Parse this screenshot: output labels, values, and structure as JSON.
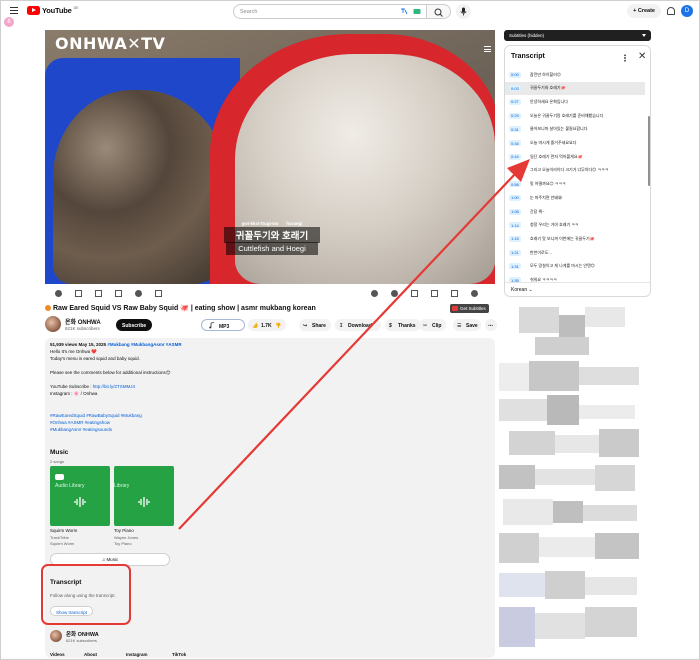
{
  "header": {
    "logo_text": "YouTube",
    "logo_sup": "DE",
    "search_placeholder": "Search",
    "create_label": "Create",
    "avatar_letter": "D",
    "side_badge": "8"
  },
  "player": {
    "watermark": "ONHWA✕TV",
    "caption_roman_1": "gwi-kkol-ttugi-wa",
    "caption_roman_2": "horaegi",
    "caption_korean": "귀꼴두기와 호래기",
    "caption_english": "Cuttlefish and Hoegi"
  },
  "video": {
    "title": "Raw Eared Squid VS Raw Baby Squid 🐙 | eating show | asmr mukbang korean",
    "get_subtitles_label": "Get Subtitles",
    "channel_name": "온화 ONHWA",
    "channel_subs": "621K subscribers",
    "subscribe_label": "Subscribe",
    "mp3_label": "MP3",
    "like_count": "1.7K",
    "share_label": "Share",
    "download_label": "Download",
    "thanks_label": "Thanks",
    "clip_label": "Clip",
    "save_label": "Save"
  },
  "description": {
    "meta_views": "51,939 views  May 15, 2025",
    "meta_tags": "#Mukbang #MukbangAsmr #ASMR",
    "line1": "Hello It's me Onhwa ❤️",
    "line2": "Today's menu is eared squid and baby squid.",
    "line3": "Please see the comments below for additional instructions😊",
    "line4_label": "YouTube Subscribe :",
    "line4_link": "http://bit.ly/2TSMMJ4",
    "line5": "Instagram : 🌸 / Onhwa",
    "tags1": "#RawEaredSquid #RawBabySquid #Mukbang",
    "tags2": "#Onhwa #ASMR #eatingshow",
    "tags3": "#MukbangAsmr #eatingsounds"
  },
  "music": {
    "title": "Music",
    "count": "2 songs",
    "cards": [
      {
        "overlay": "Audio Library",
        "name": "Squirm Worm",
        "artist": "TrackTribe",
        "album": "Squirm Worm"
      },
      {
        "overlay": "Library",
        "name": "Toy Piano",
        "artist": "Wayne Jones",
        "album": "Toy Piano"
      }
    ],
    "button_label": "Music"
  },
  "transcript_section": {
    "title": "Transcript",
    "subtitle": "Follow along using the transcript.",
    "button_label": "Show transcript"
  },
  "channel_footer": {
    "name": "온화 ONHWA",
    "subs": "621K subscribers",
    "links": [
      "Videos",
      "About",
      "Instagram",
      "TikTok"
    ]
  },
  "transcript_panel": {
    "subtitles_bar": "Subtitles (hidden)",
    "title": "Transcript",
    "language": "Korean",
    "rows": [
      {
        "time": "0:00",
        "text": "잠깐만 하이할러😊"
      },
      {
        "time": "0:03",
        "text": "귀꼴두기와 호래기🐙"
      },
      {
        "time": "0:27",
        "text": "안녕하세요 온화입니다"
      },
      {
        "time": "0:29",
        "text": "오늘은 귀꼴두기랑 호래기를 준비해봤습니다"
      },
      {
        "time": "0:31",
        "text": "물어보니까 살아있는 불필요합니다"
      },
      {
        "time": "0:34",
        "text": "오늘 마시게 즐거주세요요다"
      },
      {
        "time": "0:44",
        "text": "일단 호래기 먼저 먹어볼게요🐙"
      },
      {
        "time": "0:54",
        "text": "그리고 오늘이라이다 크기가 너무아다😊 ㅋㅋㅋ"
      },
      {
        "time": "0:58",
        "text": "맛 어떨까요😊 ㅋㅋㅋ"
      },
      {
        "time": "1:00",
        "text": "눈 마주치면 안돼😁"
      },
      {
        "time": "1:08",
        "text": "간장 찍~"
      },
      {
        "time": "1:14",
        "text": "청정 우리는 거야 호래기 ㅋㅋ"
      },
      {
        "time": "1:15",
        "text": "호래기 맛 보니까 이번에는 귀꼴두기🐙"
      },
      {
        "time": "1:21",
        "text": "반반이로도…"
      },
      {
        "time": "1:31",
        "text": "모두 망설이고 게 나게를 마시는 안텐😊"
      },
      {
        "time": "1:35",
        "text": "쉬워요 ㅋㅋㅋㅋ"
      }
    ]
  },
  "colors": {
    "accent_red": "#e53935",
    "link_blue": "#065fd4",
    "music_green": "#25a244",
    "brand_red": "#ff0000"
  }
}
